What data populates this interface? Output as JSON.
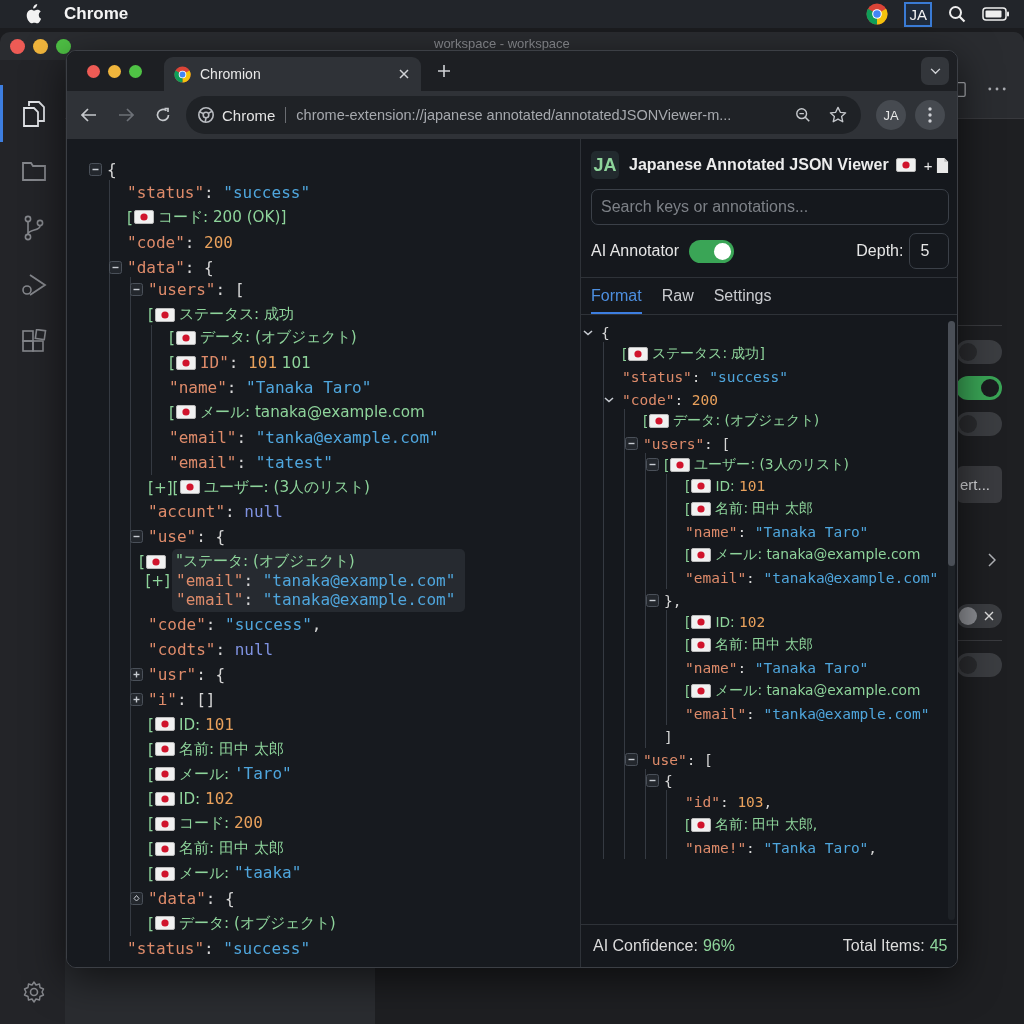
{
  "menu_bar": {
    "app_name": "Chrome",
    "extension_badge": "JA"
  },
  "back_window": {
    "title": "workspace - workspace",
    "activity_items": [
      {
        "kind": "files",
        "selected": true
      },
      {
        "kind": "folder",
        "selected": false
      },
      {
        "kind": "branch",
        "selected": false
      },
      {
        "kind": "debug",
        "selected": false
      },
      {
        "kind": "extensions",
        "selected": false
      }
    ],
    "settings_rows": [
      {
        "kind": "switch",
        "on": false
      },
      {
        "kind": "switch",
        "on": true
      },
      {
        "kind": "switch",
        "on": false
      },
      {
        "kind": "button",
        "label": "ert..."
      },
      {
        "kind": "chevron"
      },
      {
        "kind": "clear_switch",
        "on": false
      },
      {
        "kind": "switch",
        "on": false
      }
    ]
  },
  "browser": {
    "tabs": [
      {
        "label": "Chromion",
        "selected": true
      }
    ],
    "forward_disabled": true,
    "address": {
      "site": "Chrome",
      "url": "chrome-extension://japanese annotated/annotatedJSONViewer-m..."
    },
    "extension_button": "JA"
  },
  "json_view": {
    "nodes": [
      {
        "kind": "box",
        "expanded": true,
        "segs": [
          {
            "kind": "punct",
            "text": "{"
          }
        ],
        "children": [
          {
            "segs": [
              {
                "kind": "key",
                "text": "\"status\""
              },
              {
                "kind": "punct",
                "text": ": "
              },
              {
                "kind": "str",
                "text": "\"success\""
              }
            ]
          },
          {
            "segs": [
              {
                "kind": "note",
                "text": "["
              },
              {
                "kind": "flag"
              },
              {
                "kind": "note",
                "text": "コード: 200 (OK)]"
              }
            ]
          },
          {
            "segs": [
              {
                "kind": "key",
                "text": "\"code\""
              },
              {
                "kind": "punct",
                "text": ": "
              },
              {
                "kind": "num",
                "text": "200"
              }
            ]
          },
          {
            "kind": "box",
            "expanded": true,
            "segs": [
              {
                "kind": "key",
                "text": "\"data\""
              },
              {
                "kind": "punct",
                "text": ": {"
              }
            ],
            "children": [
              {
                "kind": "box",
                "expanded": true,
                "segs": [
                  {
                    "kind": "key",
                    "text": "\"users\""
                  },
                  {
                    "kind": "punct",
                    "text": ": ["
                  }
                ]
              },
              {
                "segs": [
                  {
                    "kind": "note",
                    "text": "["
                  },
                  {
                    "kind": "flag"
                  },
                  {
                    "kind": "note",
                    "text": "ステータス: 成功"
                  }
                ],
                "children": [
                  {
                    "segs": [
                      {
                        "kind": "note",
                        "text": "["
                      },
                      {
                        "kind": "flag"
                      },
                      {
                        "kind": "note",
                        "text": "データ: (オブジェクト)"
                      }
                    ]
                  },
                  {
                    "segs": [
                      {
                        "kind": "note",
                        "text": "["
                      },
                      {
                        "kind": "flag"
                      },
                      {
                        "kind": "key",
                        "text": "ID\""
                      },
                      {
                        "kind": "punct",
                        "text": ": "
                      },
                      {
                        "kind": "num",
                        "text": "101"
                      },
                      {
                        "kind": "note",
                        "text": " 101"
                      }
                    ]
                  },
                  {
                    "segs": [
                      {
                        "kind": "key",
                        "text": "\"name\""
                      },
                      {
                        "kind": "punct",
                        "text": ": "
                      },
                      {
                        "kind": "str",
                        "text": "\"Tanaka Taro\""
                      }
                    ]
                  },
                  {
                    "segs": [
                      {
                        "kind": "note",
                        "text": "["
                      },
                      {
                        "kind": "flag"
                      },
                      {
                        "kind": "note",
                        "text": "メール: tanaka@example.com"
                      }
                    ]
                  },
                  {
                    "segs": [
                      {
                        "kind": "key",
                        "text": "\"email\""
                      },
                      {
                        "kind": "punct",
                        "text": ": "
                      },
                      {
                        "kind": "str",
                        "text": "\"tanka@example.com\""
                      }
                    ]
                  },
                  {
                    "segs": [
                      {
                        "kind": "key",
                        "text": "\"email\""
                      },
                      {
                        "kind": "punct",
                        "text": ": "
                      },
                      {
                        "kind": "str",
                        "text": "\"tatest\""
                      }
                    ]
                  }
                ]
              },
              {
                "segs": [
                  {
                    "kind": "note",
                    "text": "[+]["
                  },
                  {
                    "kind": "flag"
                  },
                  {
                    "kind": "note",
                    "text": "ユーザー: (3人のリスト)"
                  }
                ]
              },
              {
                "segs": [
                  {
                    "kind": "key",
                    "text": "\"accunt\""
                  },
                  {
                    "kind": "punct",
                    "text": ": "
                  },
                  {
                    "kind": "null",
                    "text": "null"
                  }
                ]
              },
              {
                "kind": "box",
                "expanded": true,
                "segs": [
                  {
                    "kind": "key",
                    "text": "\"use\""
                  },
                  {
                    "kind": "punct",
                    "text": ": {"
                  }
                ]
              },
              {
                "kind": "popup",
                "lines": [
                  {
                    "lead": [
                      {
                        "kind": "note",
                        "text": "["
                      },
                      {
                        "kind": "flag"
                      }
                    ],
                    "segs": [
                      {
                        "kind": "note",
                        "text": "\"ステータ: (オブジェクト)"
                      }
                    ]
                  },
                  {
                    "lead": [
                      {
                        "kind": "note",
                        "text": "[+]"
                      }
                    ],
                    "segs": [
                      {
                        "kind": "key",
                        "text": "\"email\""
                      },
                      {
                        "kind": "punct",
                        "text": ": "
                      },
                      {
                        "kind": "str",
                        "text": "\"tanaka@example.com\""
                      }
                    ]
                  },
                  {
                    "segs": [
                      {
                        "kind": "key",
                        "text": " \"email\""
                      },
                      {
                        "kind": "punct",
                        "text": ": "
                      },
                      {
                        "kind": "str",
                        "text": "\"tanaka@example.com\""
                      }
                    ]
                  }
                ]
              },
              {
                "segs": [
                  {
                    "kind": "key",
                    "text": "\"code\""
                  },
                  {
                    "kind": "punct",
                    "text": ": "
                  },
                  {
                    "kind": "str",
                    "text": "\"success\""
                  },
                  {
                    "kind": "punct",
                    "text": ","
                  }
                ]
              },
              {
                "segs": [
                  {
                    "kind": "key",
                    "text": "\"codts\""
                  },
                  {
                    "kind": "punct",
                    "text": ": "
                  },
                  {
                    "kind": "null",
                    "text": "null"
                  }
                ]
              },
              {
                "kind": "box",
                "expanded": false,
                "segs": [
                  {
                    "kind": "key",
                    "text": "\"usr\""
                  },
                  {
                    "kind": "punct",
                    "text": ": {"
                  }
                ]
              },
              {
                "kind": "box",
                "expanded": false,
                "segs": [
                  {
                    "kind": "key",
                    "text": "\"i\""
                  },
                  {
                    "kind": "punct",
                    "text": ": []"
                  }
                ]
              },
              {
                "segs": [
                  {
                    "kind": "note",
                    "text": "["
                  },
                  {
                    "kind": "flag"
                  },
                  {
                    "kind": "note",
                    "text": "ID: "
                  },
                  {
                    "kind": "num",
                    "text": "101"
                  }
                ]
              },
              {
                "segs": [
                  {
                    "kind": "note",
                    "text": "["
                  },
                  {
                    "kind": "flag"
                  },
                  {
                    "kind": "note",
                    "text": "名前: 田中 太郎"
                  }
                ]
              },
              {
                "segs": [
                  {
                    "kind": "note",
                    "text": "["
                  },
                  {
                    "kind": "flag"
                  },
                  {
                    "kind": "note",
                    "text": "メール: "
                  },
                  {
                    "kind": "str",
                    "text": "'Taro\""
                  }
                ]
              },
              {
                "segs": [
                  {
                    "kind": "note",
                    "text": "["
                  },
                  {
                    "kind": "flag"
                  },
                  {
                    "kind": "note",
                    "text": "ID: "
                  },
                  {
                    "kind": "num",
                    "text": "102"
                  }
                ]
              },
              {
                "segs": [
                  {
                    "kind": "note",
                    "text": "["
                  },
                  {
                    "kind": "flag"
                  },
                  {
                    "kind": "note",
                    "text": "コード: "
                  },
                  {
                    "kind": "num",
                    "text": "200"
                  }
                ]
              },
              {
                "segs": [
                  {
                    "kind": "note",
                    "text": "["
                  },
                  {
                    "kind": "flag"
                  },
                  {
                    "kind": "note",
                    "text": "名前: 田中 太郎"
                  }
                ]
              },
              {
                "segs": [
                  {
                    "kind": "note",
                    "text": "["
                  },
                  {
                    "kind": "flag"
                  },
                  {
                    "kind": "note",
                    "text": "メール: "
                  },
                  {
                    "kind": "str",
                    "text": "\"taaka\""
                  }
                ]
              },
              {
                "kind": "dot",
                "segs": [
                  {
                    "kind": "key",
                    "text": "\"data\""
                  },
                  {
                    "kind": "punct",
                    "text": ": {"
                  }
                ]
              },
              {
                "segs": [
                  {
                    "kind": "note",
                    "text": "["
                  },
                  {
                    "kind": "flag"
                  },
                  {
                    "kind": "note",
                    "text": "データ: (オブジェクト)"
                  }
                ]
              }
            ]
          },
          {
            "segs": [
              {
                "kind": "key",
                "text": "\"status\""
              },
              {
                "kind": "punct",
                "text": ": "
              },
              {
                "kind": "str",
                "text": "\"success\""
              }
            ]
          }
        ]
      }
    ]
  },
  "extension_panel": {
    "logo": "JA",
    "title": "Japanese Annotated JSON Viewer",
    "title_joiner": "+",
    "search": {
      "placeholder": "Search keys or annotations..."
    },
    "ai_annotator": {
      "label": "AI Annotator",
      "on": true
    },
    "depth": {
      "label": "Depth:",
      "value": "5"
    },
    "tabs": [
      {
        "label": "Format",
        "selected": true
      },
      {
        "label": "Raw",
        "selected": false
      },
      {
        "label": "Settings",
        "selected": false
      }
    ],
    "tree": [
      {
        "kind": "caret",
        "expanded": true,
        "segs": [
          {
            "kind": "punct",
            "text": "{"
          }
        ],
        "children": [
          {
            "segs": [
              {
                "kind": "note",
                "text": "["
              },
              {
                "kind": "flag"
              },
              {
                "kind": "note",
                "text": "ステータス: 成功]"
              }
            ]
          },
          {
            "segs": [
              {
                "kind": "key",
                "text": "\"status\""
              },
              {
                "kind": "punct",
                "text": ": "
              },
              {
                "kind": "str",
                "text": "\"success\""
              }
            ]
          },
          {
            "kind": "caret",
            "expanded": true,
            "segs": [
              {
                "kind": "key",
                "text": "\"code\""
              },
              {
                "kind": "punct",
                "text": ": "
              },
              {
                "kind": "num",
                "text": "200"
              }
            ],
            "children": [
              {
                "segs": [
                  {
                    "kind": "note",
                    "text": "["
                  },
                  {
                    "kind": "flag"
                  },
                  {
                    "kind": "note",
                    "text": "データ: (オブジェクト)"
                  }
                ]
              },
              {
                "kind": "box",
                "expanded": true,
                "segs": [
                  {
                    "kind": "key",
                    "text": "\"users\""
                  },
                  {
                    "kind": "punct",
                    "text": ": ["
                  }
                ],
                "children": [
                  {
                    "kind": "box",
                    "expanded": true,
                    "segs": [
                      {
                        "kind": "note",
                        "text": "["
                      },
                      {
                        "kind": "flag"
                      },
                      {
                        "kind": "note",
                        "text": "ユーザー: (3人のリスト)"
                      }
                    ],
                    "children": [
                      {
                        "segs": [
                          {
                            "kind": "note",
                            "text": "["
                          },
                          {
                            "kind": "flag"
                          },
                          {
                            "kind": "note",
                            "text": "ID: "
                          },
                          {
                            "kind": "num",
                            "text": "101"
                          }
                        ]
                      },
                      {
                        "segs": [
                          {
                            "kind": "note",
                            "text": "["
                          },
                          {
                            "kind": "flag"
                          },
                          {
                            "kind": "note",
                            "text": "名前: 田中 太郎"
                          }
                        ]
                      },
                      {
                        "segs": [
                          {
                            "kind": "key",
                            "text": "\"name\""
                          },
                          {
                            "kind": "punct",
                            "text": ": "
                          },
                          {
                            "kind": "str",
                            "text": "\"Tanaka Taro\""
                          }
                        ]
                      },
                      {
                        "segs": [
                          {
                            "kind": "note",
                            "text": "["
                          },
                          {
                            "kind": "flag"
                          },
                          {
                            "kind": "note",
                            "text": "メール: tanaka@example.com"
                          }
                        ]
                      },
                      {
                        "segs": [
                          {
                            "kind": "key",
                            "text": "\"email\""
                          },
                          {
                            "kind": "punct",
                            "text": ": "
                          },
                          {
                            "kind": "str",
                            "text": "\"tanaka@example.com\""
                          }
                        ]
                      }
                    ]
                  },
                  {
                    "kind": "box",
                    "expanded": true,
                    "segs": [
                      {
                        "kind": "punct",
                        "text": "},"
                      }
                    ],
                    "children": [
                      {
                        "segs": [
                          {
                            "kind": "note",
                            "text": "["
                          },
                          {
                            "kind": "flag"
                          },
                          {
                            "kind": "note",
                            "text": "ID: "
                          },
                          {
                            "kind": "num",
                            "text": "102"
                          }
                        ]
                      },
                      {
                        "segs": [
                          {
                            "kind": "note",
                            "text": "["
                          },
                          {
                            "kind": "flag"
                          },
                          {
                            "kind": "note",
                            "text": "名前: 田中 太郎"
                          }
                        ]
                      },
                      {
                        "segs": [
                          {
                            "kind": "key",
                            "text": "\"name\""
                          },
                          {
                            "kind": "punct",
                            "text": ": "
                          },
                          {
                            "kind": "str",
                            "text": "\"Tanaka Taro\""
                          }
                        ]
                      },
                      {
                        "segs": [
                          {
                            "kind": "note",
                            "text": "["
                          },
                          {
                            "kind": "flag"
                          },
                          {
                            "kind": "note",
                            "text": "メール: tanaka@example.com"
                          }
                        ]
                      },
                      {
                        "segs": [
                          {
                            "kind": "key",
                            "text": "\"email\""
                          },
                          {
                            "kind": "punct",
                            "text": ": "
                          },
                          {
                            "kind": "str",
                            "text": "\"tanka@example.com\""
                          }
                        ]
                      }
                    ]
                  },
                  {
                    "segs": [
                      {
                        "kind": "punct",
                        "text": "]"
                      }
                    ]
                  }
                ]
              },
              {
                "kind": "box",
                "expanded": true,
                "segs": [
                  {
                    "kind": "key",
                    "text": "\"use\""
                  },
                  {
                    "kind": "punct",
                    "text": ": ["
                  }
                ],
                "children": [
                  {
                    "kind": "box",
                    "expanded": true,
                    "segs": [
                      {
                        "kind": "punct",
                        "text": "{"
                      }
                    ],
                    "children": [
                      {
                        "segs": [
                          {
                            "kind": "key",
                            "text": "\"id\""
                          },
                          {
                            "kind": "punct",
                            "text": ": "
                          },
                          {
                            "kind": "num",
                            "text": "103"
                          },
                          {
                            "kind": "punct",
                            "text": ","
                          }
                        ]
                      },
                      {
                        "segs": [
                          {
                            "kind": "note",
                            "text": "["
                          },
                          {
                            "kind": "flag"
                          },
                          {
                            "kind": "note",
                            "text": "名前: 田中 太郎,"
                          }
                        ]
                      },
                      {
                        "segs": [
                          {
                            "kind": "key",
                            "text": "\"name!\""
                          },
                          {
                            "kind": "punct",
                            "text": ": "
                          },
                          {
                            "kind": "str",
                            "text": "\"Tanka Taro\""
                          },
                          {
                            "kind": "punct",
                            "text": ","
                          }
                        ]
                      }
                    ]
                  }
                ]
              }
            ]
          }
        ]
      }
    ],
    "footer": {
      "confidence_label": "AI Confidence:",
      "confidence_value": "96%",
      "total_label": "Total Items:",
      "total_value": "45"
    }
  }
}
